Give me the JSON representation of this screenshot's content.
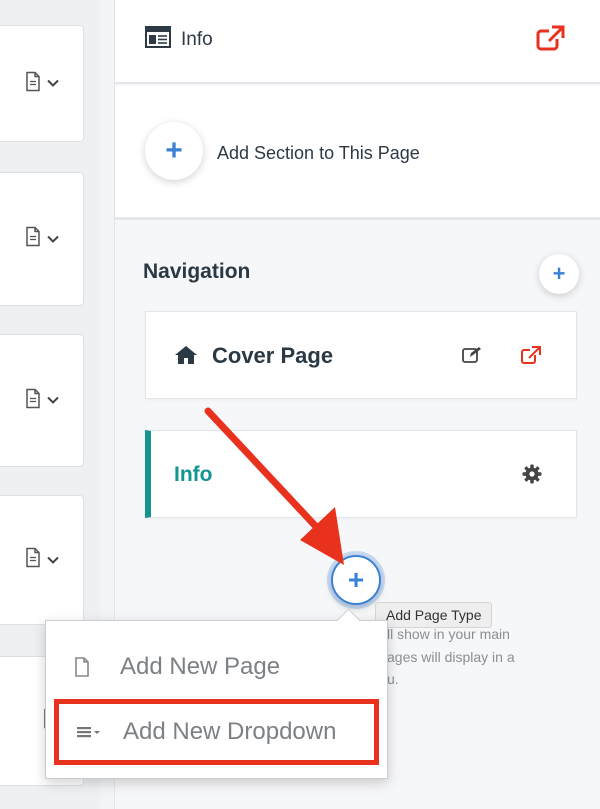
{
  "left_cards": [
    {
      "page_icon": "document-icon",
      "chevron": "chevron-down-icon"
    },
    {
      "page_icon": "document-icon",
      "chevron": "chevron-down-icon"
    },
    {
      "page_icon": "document-icon",
      "chevron": "chevron-down-icon"
    },
    {
      "page_icon": "document-icon",
      "chevron": "chevron-down-icon"
    },
    {
      "page_icon": "document-icon"
    }
  ],
  "header": {
    "title": "Info",
    "icon": "page-layout-icon",
    "action_icon": "external-link-icon"
  },
  "add_section": {
    "label": "Add Section to This Page"
  },
  "navigation": {
    "title": "Navigation",
    "items": [
      {
        "label": "Cover Page",
        "icon": "home-icon",
        "actions": [
          "edit-icon",
          "external-link-icon"
        ]
      },
      {
        "label": "Info",
        "actions": [
          "gear-icon"
        ],
        "active": true
      }
    ]
  },
  "add_page_type": {
    "tooltip": "Add Page Type"
  },
  "hint": {
    "line1": "ll show in your main",
    "line2": "ages will display in a",
    "line3": "u."
  },
  "menu": {
    "items": [
      {
        "label": "Add New Page",
        "icon": "blank-page-icon"
      },
      {
        "label": "Add New Dropdown",
        "icon": "menu-lines-icon",
        "highlighted": true
      }
    ]
  },
  "colors": {
    "accent_blue": "#3b82d6",
    "teal": "#14938f",
    "external_red": "#e8321e",
    "annotation_red": "#e8321e"
  }
}
